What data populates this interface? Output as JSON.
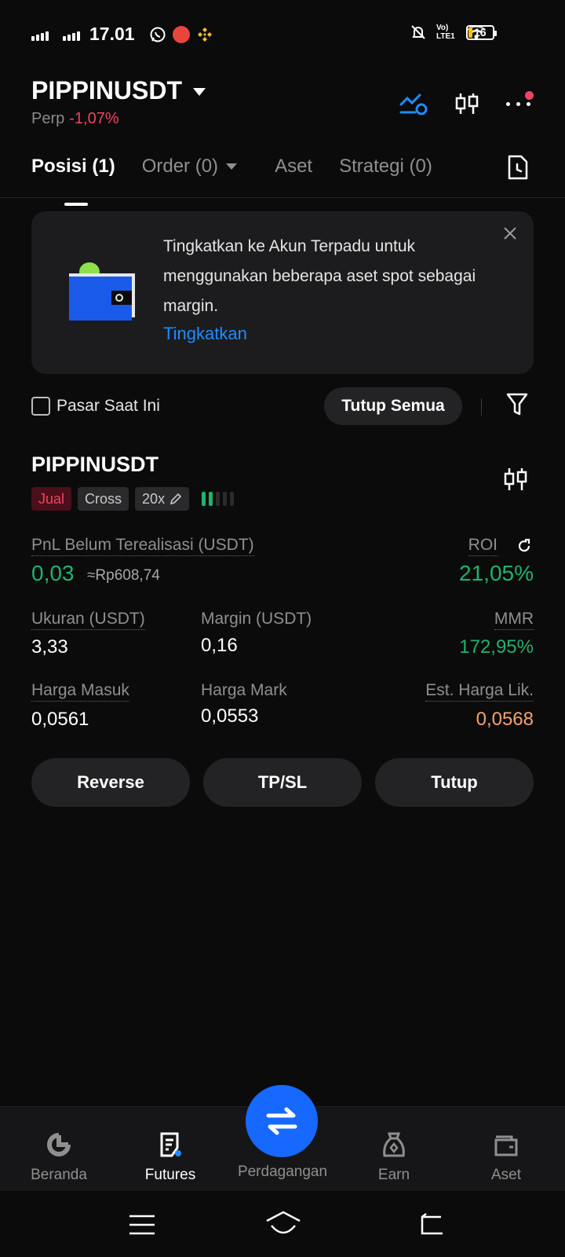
{
  "status_bar": {
    "time": "17.01",
    "network_label": "Vo) LTE1",
    "battery": "16",
    "battery_level": 0.16
  },
  "header": {
    "symbol": "PIPPINUSDT",
    "contract_type": "Perp",
    "change": "-1,07%"
  },
  "tabs": [
    {
      "label": "Posisi (1)",
      "active": true
    },
    {
      "label": "Order (0)",
      "active": false
    },
    {
      "label": "Aset",
      "active": false
    },
    {
      "label": "Strategi (0)",
      "active": false
    }
  ],
  "banner": {
    "text": "Tingkatkan ke Akun Terpadu untuk menggunakan beberapa aset spot sebagai margin.",
    "link": "Tingkatkan"
  },
  "filter": {
    "checkbox_label": "Pasar Saat Ini",
    "checked": false,
    "close_all": "Tutup Semua"
  },
  "position": {
    "symbol": "PIPPINUSDT",
    "side": "Jual",
    "margin_mode": "Cross",
    "leverage": "20x",
    "adl_level": 2,
    "pnl_label": "PnL Belum Terealisasi (USDT)",
    "pnl_value": "0,03",
    "pnl_idr": "≈Rp608,74",
    "roi_label": "ROI",
    "roi_value": "21,05%",
    "size_label": "Ukuran (USDT)",
    "size_value": "3,33",
    "margin_label": "Margin (USDT)",
    "margin_value": "0,16",
    "mmr_label": "MMR",
    "mmr_value": "172,95%",
    "entry_label": "Harga Masuk",
    "entry_value": "0,0561",
    "mark_label": "Harga Mark",
    "mark_value": "0,0553",
    "liq_label": "Est. Harga Lik.",
    "liq_value": "0,0568"
  },
  "actions": {
    "reverse": "Reverse",
    "tpsl": "TP/SL",
    "close": "Tutup"
  },
  "bottom_nav": [
    {
      "label": "Beranda",
      "icon": "home-icon",
      "active": false
    },
    {
      "label": "Futures",
      "icon": "futures-icon",
      "active": true
    },
    {
      "label": "Perdagangan",
      "icon": "trade-swap-icon",
      "active": false
    },
    {
      "label": "Earn",
      "icon": "earn-icon",
      "active": false
    },
    {
      "label": "Aset",
      "icon": "wallet-icon",
      "active": false
    }
  ],
  "colors": {
    "positive": "#20b26b",
    "negative": "#ef4560",
    "accent": "#1768ff",
    "link": "#1e8cff",
    "liquidation": "#f6a36c"
  }
}
